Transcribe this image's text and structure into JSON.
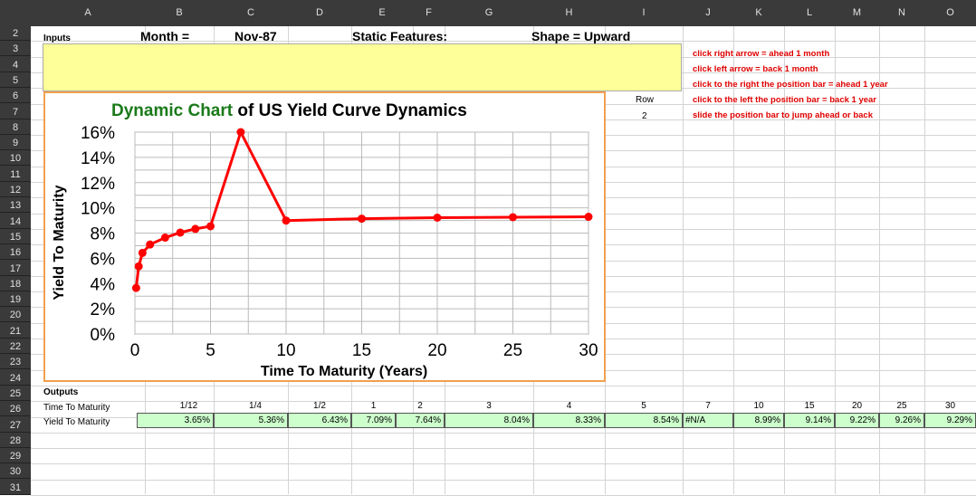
{
  "columns": [
    "A",
    "B",
    "C",
    "D",
    "E",
    "F",
    "G",
    "H",
    "I",
    "J",
    "K",
    "L",
    "M",
    "N",
    "O"
  ],
  "rows": [
    "2",
    "3",
    "4",
    "5",
    "6",
    "7",
    "8",
    "9",
    "10",
    "11",
    "12",
    "13",
    "14",
    "15",
    "16",
    "17",
    "18",
    "19",
    "20",
    "21",
    "22",
    "23",
    "24",
    "25",
    "26",
    "27",
    "28",
    "29",
    "30",
    "31"
  ],
  "inputs": {
    "label": "Inputs",
    "month_label": "Month =",
    "month_value": "Nov-87",
    "static_label": "Static Features:",
    "shape_label": "Shape = Upward"
  },
  "row_box": {
    "label": "Row",
    "value": "2"
  },
  "instructions": [
    "click right arrow = ahead 1 month",
    "click left arrow = back 1 month",
    "click to the right the position bar = ahead 1 year",
    "click to the left the position bar = back 1 year",
    "slide the position bar to jump ahead or back"
  ],
  "outputs": {
    "label": "Outputs",
    "maturity_label": "Time To Maturity",
    "yield_label": "Yield To Maturity",
    "maturities": [
      "1/12",
      "1/4",
      "1/2",
      "1",
      "2",
      "3",
      "4",
      "5",
      "7",
      "10",
      "15",
      "20",
      "25",
      "30"
    ],
    "yields": [
      "3.65%",
      "5.36%",
      "6.43%",
      "7.09%",
      "7.64%",
      "8.04%",
      "8.33%",
      "8.54%",
      "#N/A",
      "8.99%",
      "9.14%",
      "9.22%",
      "9.26%",
      "9.29%"
    ]
  },
  "colors": {
    "title_green": "#1a7a1a",
    "series": "#ff0000",
    "chart_border": "#f0a050",
    "input_band": "#ffff99",
    "output_band": "#ccffcc",
    "note_red": "#e00000"
  },
  "chart_data": {
    "type": "line",
    "title_part1": "Dynamic Chart",
    "title_part2": " of US Yield Curve Dynamics",
    "xlabel": "Time To Maturity (Years)",
    "ylabel": "Yield To Maturity",
    "xlim": [
      0,
      30
    ],
    "ylim": [
      0,
      16
    ],
    "xticks": [
      0,
      5,
      10,
      15,
      20,
      25,
      30
    ],
    "yticks": [
      0,
      2,
      4,
      6,
      8,
      10,
      12,
      14,
      16
    ],
    "ytick_labels": [
      "0%",
      "2%",
      "4%",
      "6%",
      "8%",
      "10%",
      "12%",
      "14%",
      "16%"
    ],
    "grid": true,
    "x": [
      0.0833,
      0.25,
      0.5,
      1,
      2,
      3,
      4,
      5,
      7,
      10,
      15,
      20,
      25,
      30
    ],
    "y": [
      3.65,
      5.36,
      6.43,
      7.09,
      7.64,
      8.04,
      8.33,
      8.54,
      16.0,
      8.99,
      9.14,
      9.22,
      9.26,
      9.29
    ]
  }
}
